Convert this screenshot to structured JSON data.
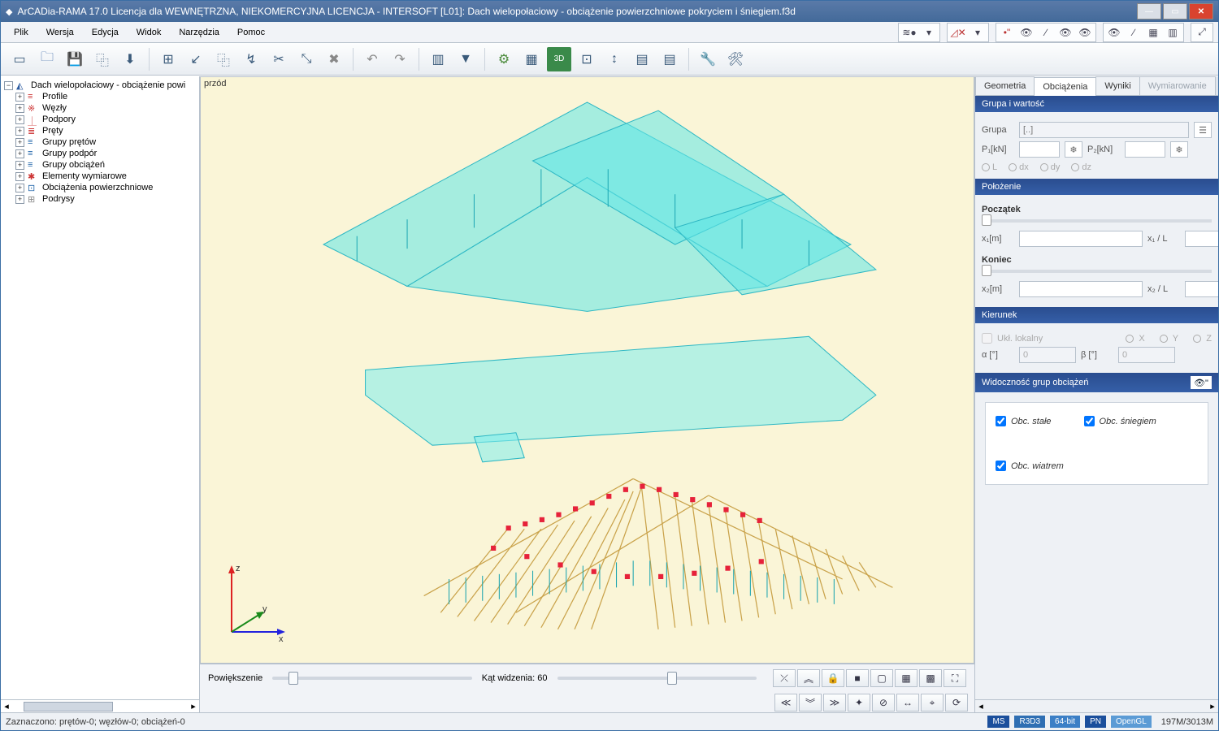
{
  "title": "ArCADia-RAMA 17.0 Licencja dla WEWNĘTRZNA, NIEKOMERCYJNA LICENCJA - INTERSOFT [L01]: Dach wielopołaciowy - obciążenie powierzchniowe pokryciem i śniegiem.f3d",
  "menu": [
    "Plik",
    "Wersja",
    "Edycja",
    "Widok",
    "Narzędzia",
    "Pomoc"
  ],
  "tree": {
    "root": "Dach wielopołaciowy - obciążenie powi",
    "items": [
      "Profile",
      "Węzły",
      "Podpory",
      "Pręty",
      "Grupy prętów",
      "Grupy podpór",
      "Grupy obciążeń",
      "Elementy wymiarowe",
      "Obciążenia powierzchniowe",
      "Podrysy"
    ]
  },
  "viewport_label": "przód",
  "sliders": {
    "zoom_label": "Powiększenie",
    "angle_label": "Kąt widzenia: 60"
  },
  "right": {
    "tabs": [
      "Geometria",
      "Obciążenia",
      "Wyniki",
      "Wymiarowanie"
    ],
    "active_tab": 1,
    "sec1": {
      "title": "Grupa i wartość",
      "grupa": "Grupa",
      "placeholder": "[..]",
      "p1": "P₁[kN]",
      "p2": "P₂[kN]",
      "radios": [
        "L",
        "dx",
        "dy",
        "dz"
      ]
    },
    "sec2": {
      "title": "Położenie",
      "start": "Początek",
      "end": "Koniec",
      "x1": "x₁[m]",
      "x1L": "x₁ / L",
      "x2": "x₂[m]",
      "x2L": "x₂ / L"
    },
    "sec3": {
      "title": "Kierunek",
      "ukl": "Ukł. lokalny",
      "x": "X",
      "y": "Y",
      "z": "Z",
      "alpha": "α [°]",
      "beta": "β [°]",
      "zero": "0"
    },
    "sec4": {
      "title": "Widoczność grup obciążeń",
      "c1": "Obc. stałe",
      "c2": "Obc. śniegiem",
      "c3": "Obc. wiatrem"
    }
  },
  "status": {
    "sel": "Zaznaczono: prętów-0; węzłów-0; obciążeń-0",
    "badges": [
      "MS",
      "R3D3",
      "64-bit",
      "PN",
      "OpenGL"
    ],
    "mem": "197M/3013M"
  }
}
